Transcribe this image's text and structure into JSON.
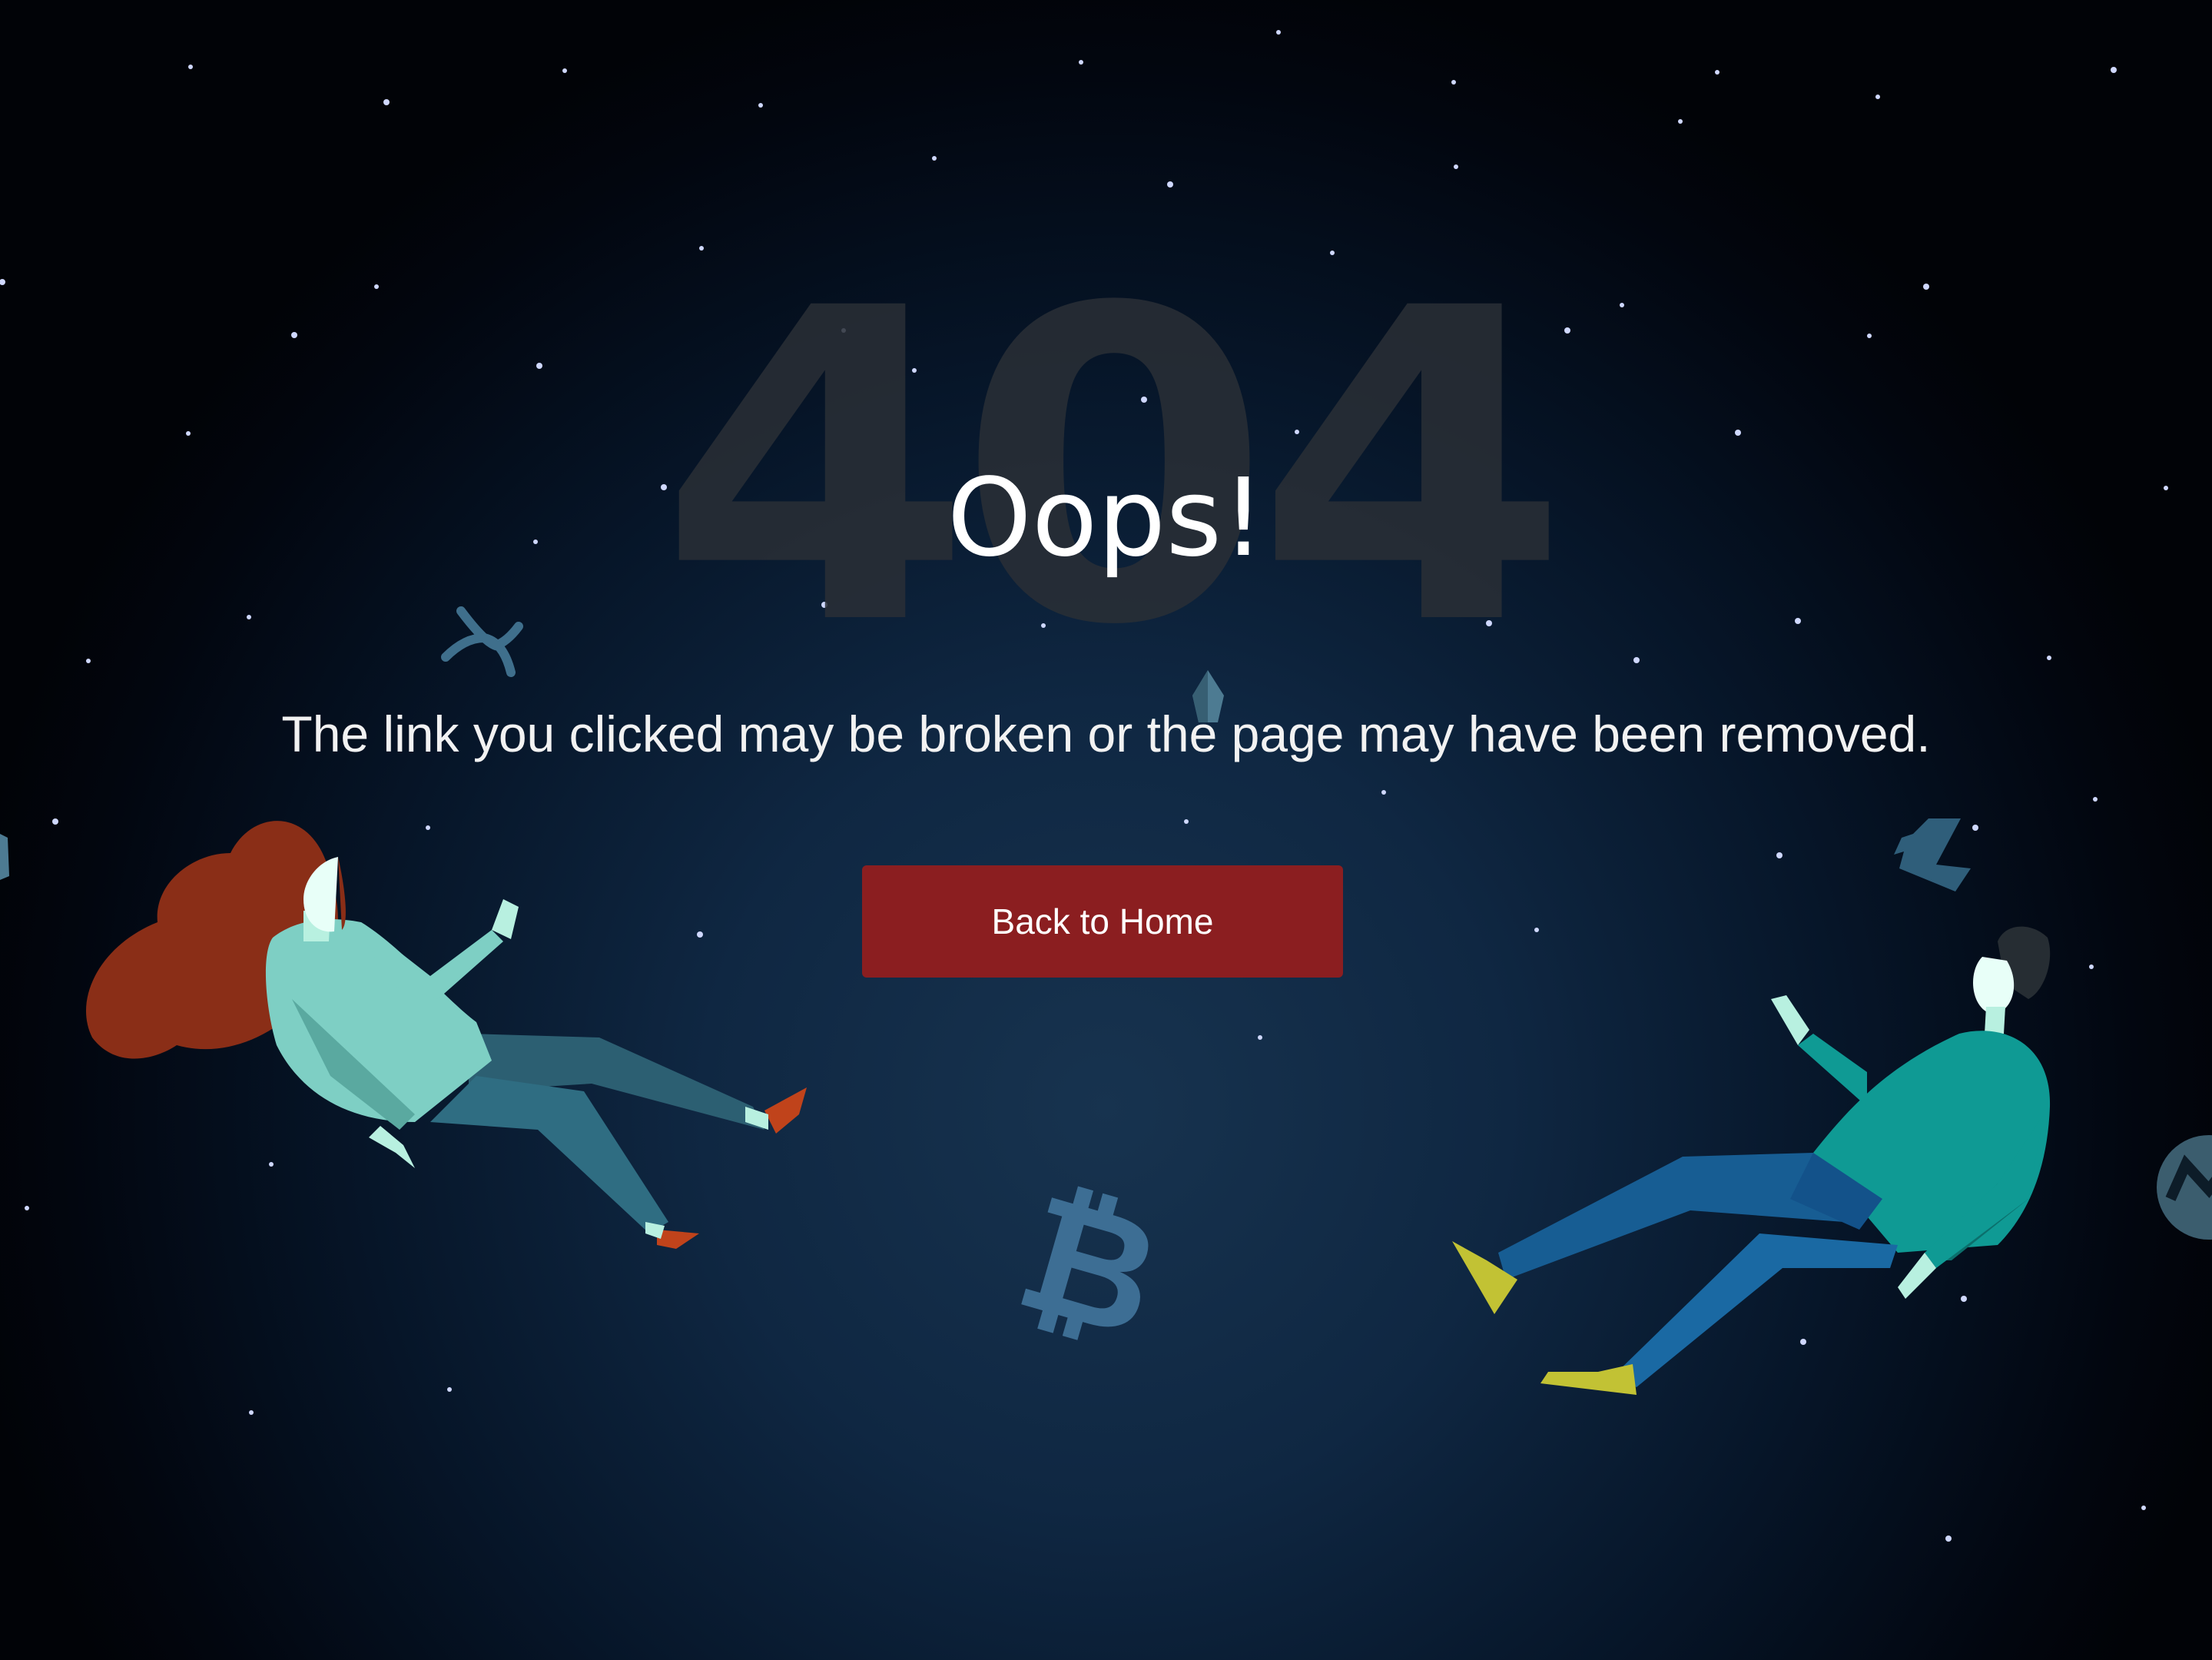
{
  "background_code": "404",
  "heading": "Oops!",
  "message": "The link you clicked may be broken or the page may have been removed.",
  "back_button_label": "Back to Home",
  "colors": {
    "button": "#8b1e20",
    "text": "#ffffff",
    "space_center": "#17334f",
    "space_edge": "#010307",
    "code_watermark": "#2a2f36"
  },
  "icons": [
    "ripple-coin-icon",
    "eos-coin-icon",
    "litecoin-icon",
    "bitcoin-icon",
    "monero-coin-icon",
    "star-icon"
  ]
}
